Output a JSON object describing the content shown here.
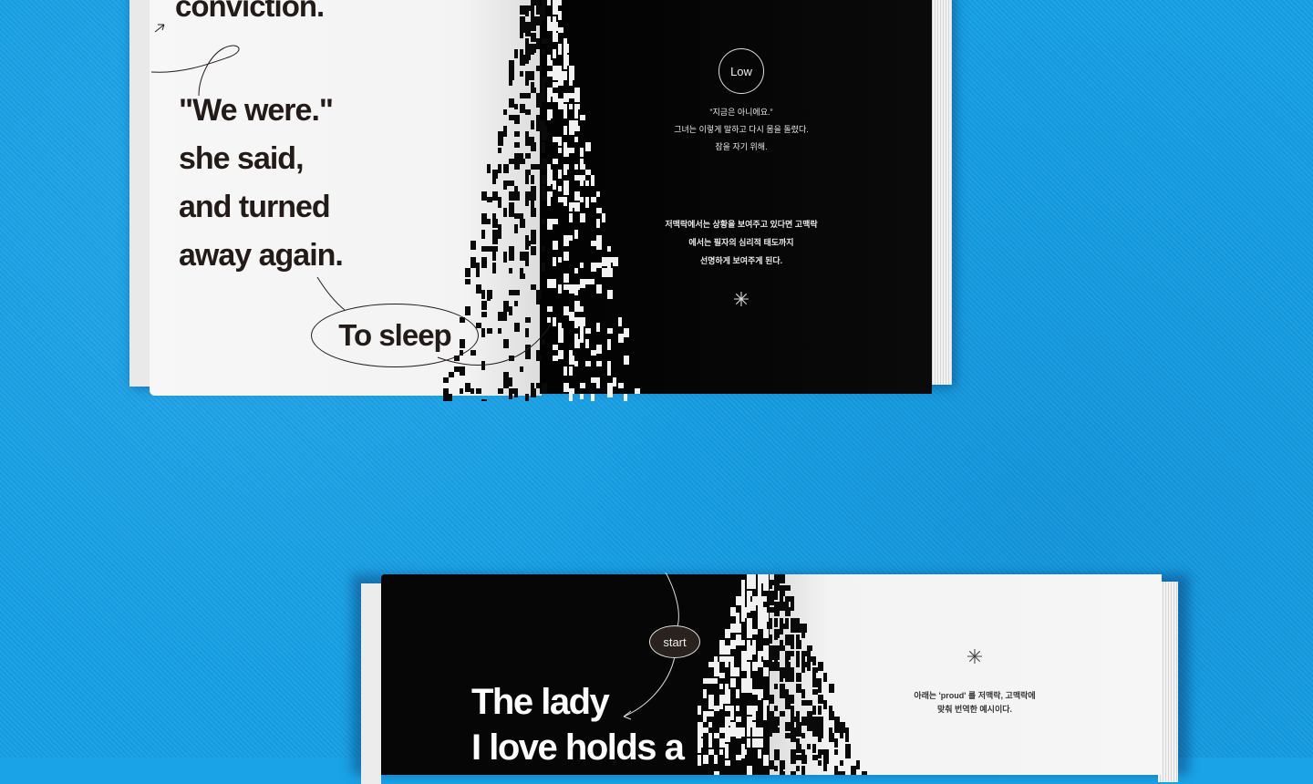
{
  "book_top": {
    "left_page": {
      "heading_partial": "conviction.",
      "quote_lines": [
        "\"We were.\"",
        "she said,",
        "and turned",
        "away again."
      ],
      "oval_label": "To sleep"
    },
    "right_page": {
      "badge": "Low",
      "korean_lines": [
        "“지금은 아니에요.”",
        "그녀는 이렇게 말하고 다시 몸을 돌렸다.",
        "잠을 자기 위해."
      ],
      "korean_note_lines": [
        "저맥락에서는 상황을 보여주고 있다면 고맥락",
        "에서는 필자의 심리적 태도까지",
        "선명하게 보여주게 된다."
      ],
      "ornament": "✳"
    }
  },
  "book_bottom": {
    "left_page": {
      "oval_label": "start",
      "heading_lines": [
        "The lady",
        "I love holds a"
      ]
    },
    "right_page": {
      "ornament": "✳",
      "korean_note_lines": [
        "아래는 'proud' 를 저맥락, 고맥락에",
        "맞춰 번역한 예시이다."
      ]
    }
  },
  "colors": {
    "background": "#16a0e4",
    "ink": "#231b18",
    "page_light": "#f5f5f5",
    "page_dark": "#050505"
  }
}
